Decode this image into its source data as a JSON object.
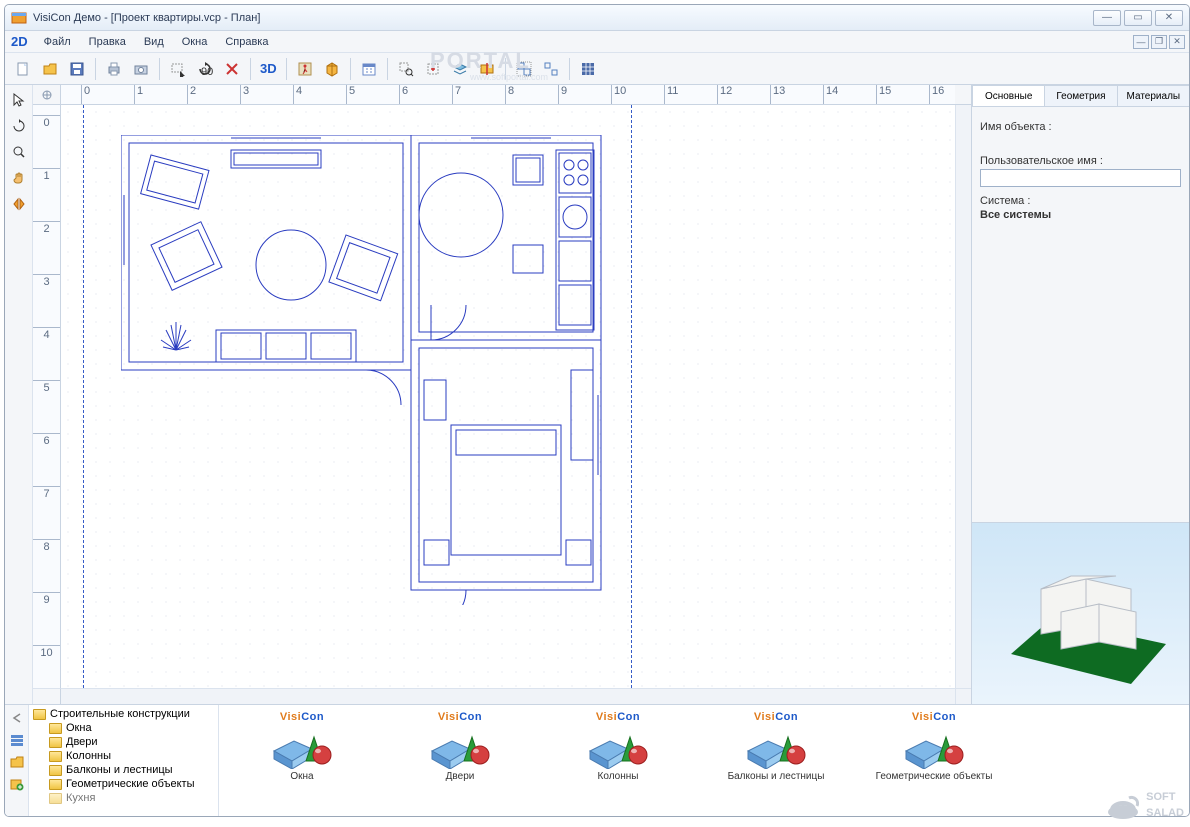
{
  "window": {
    "title": "VisiCon Демо - [Проект квартиры.vcp - План]"
  },
  "menu": {
    "logo2d": "2D",
    "items": [
      "Файл",
      "Правка",
      "Вид",
      "Окна",
      "Справка"
    ]
  },
  "toolbar": {
    "logo3d": "3D"
  },
  "ruler": {
    "h_values": [
      "0",
      "1",
      "2",
      "3",
      "4",
      "5",
      "6",
      "7",
      "8",
      "9",
      "10",
      "11",
      "12",
      "13",
      "14",
      "15",
      "16"
    ],
    "v_values": [
      "0",
      "1",
      "2",
      "3",
      "4",
      "5",
      "6",
      "7",
      "8",
      "9",
      "10"
    ]
  },
  "rightpanel": {
    "tabs": [
      "Основные",
      "Геометрия",
      "Материалы"
    ],
    "label_object_name": "Имя объекта :",
    "label_user_name": "Пользовательское имя :",
    "label_system": "Система :",
    "system_value": "Все системы",
    "object_name_value": "",
    "user_name_value": ""
  },
  "tree": {
    "root": "Строительные конструкции",
    "children": [
      "Окна",
      "Двери",
      "Колонны",
      "Балконы и лестницы",
      "Геометрические объекты",
      "Кухня"
    ]
  },
  "gallery": {
    "brand": "VisiCon",
    "items": [
      "Окна",
      "Двери",
      "Колонны",
      "Балконы и лестницы",
      "Геометрические объекты"
    ]
  },
  "watermark": {
    "main": "PORTAL",
    "sub": "www.softportal.com"
  },
  "footer_logo": {
    "line1": "SOFT",
    "line2": "SALAD"
  }
}
